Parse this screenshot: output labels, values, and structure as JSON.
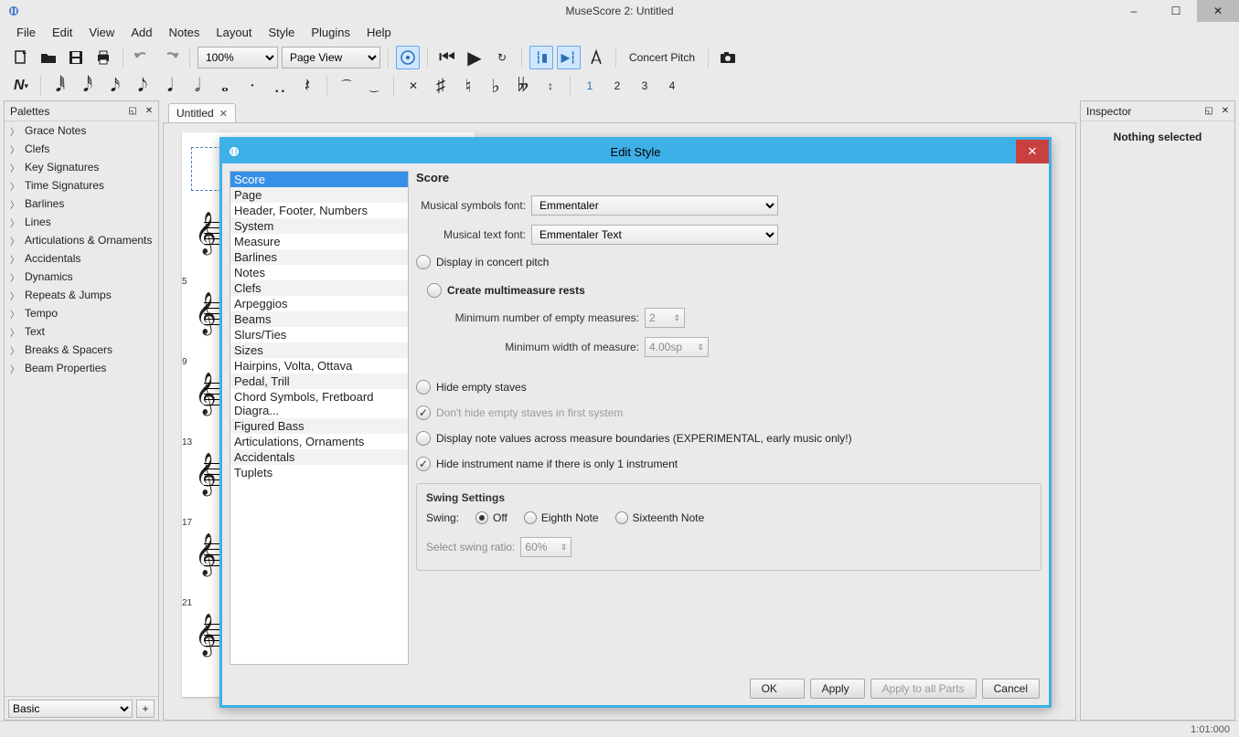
{
  "window": {
    "title": "MuseScore 2: Untitled",
    "minimize": "–",
    "maximize": "☐",
    "close": "✕"
  },
  "menus": [
    "File",
    "Edit",
    "View",
    "Add",
    "Notes",
    "Layout",
    "Style",
    "Plugins",
    "Help"
  ],
  "toolbar1": {
    "zoom": "100%",
    "view_mode": "Page View",
    "concert_pitch": "Concert Pitch"
  },
  "noterow": {
    "voice1": "1",
    "voice2": "2",
    "voice3": "3",
    "voice4": "4"
  },
  "palettes": {
    "title": "Palettes",
    "items": [
      "Grace Notes",
      "Clefs",
      "Key Signatures",
      "Time Signatures",
      "Barlines",
      "Lines",
      "Articulations & Ornaments",
      "Accidentals",
      "Dynamics",
      "Repeats & Jumps",
      "Tempo",
      "Text",
      "Breaks & Spacers",
      "Beam Properties"
    ],
    "preset": "Basic",
    "plus": "+"
  },
  "tabs": {
    "untitled": "Untitled"
  },
  "inspector": {
    "title": "Inspector",
    "body": "Nothing selected"
  },
  "statusbar": {
    "pos": "1:01:000"
  },
  "score": {
    "m1": "",
    "m5": "5",
    "m9": "9",
    "m13": "13",
    "m17": "17",
    "m21": "21"
  },
  "dialog": {
    "title": "Edit Style",
    "close": "✕",
    "list": [
      "Score",
      "Page",
      "Header, Footer, Numbers",
      "System",
      "Measure",
      "Barlines",
      "Notes",
      "Clefs",
      "Arpeggios",
      "Beams",
      "Slurs/Ties",
      "Sizes",
      "Hairpins, Volta, Ottava",
      "Pedal, Trill",
      "Chord Symbols, Fretboard Diagra...",
      "Figured Bass",
      "Articulations, Ornaments",
      "Accidentals",
      "Tuplets"
    ],
    "selected": "Score",
    "section_title": "Score",
    "labels": {
      "musical_symbols": "Musical symbols font:",
      "musical_text": "Musical text font:",
      "display_concert": "Display in concert pitch",
      "create_mmrests": "Create multimeasure rests",
      "min_empty": "Minimum number of empty measures:",
      "min_width": "Minimum width of measure:",
      "hide_empty": "Hide empty staves",
      "dont_hide_first": "Don't hide empty staves in first system",
      "display_note_values": "Display note values across measure boundaries (EXPERIMENTAL, early music only!)",
      "hide_instr": "Hide instrument name if there is only 1 instrument",
      "swing_settings": "Swing Settings",
      "swing": "Swing:",
      "off": "Off",
      "eighth": "Eighth Note",
      "sixteenth": "Sixteenth Note",
      "swing_ratio": "Select swing ratio:"
    },
    "values": {
      "symbols_font": "Emmentaler",
      "text_font": "Emmentaler Text",
      "min_empty": "2",
      "min_width": "4.00sp",
      "swing_ratio": "60%"
    },
    "buttons": {
      "ok": "OK",
      "apply": "Apply",
      "apply_all": "Apply to all Parts",
      "cancel": "Cancel"
    }
  }
}
